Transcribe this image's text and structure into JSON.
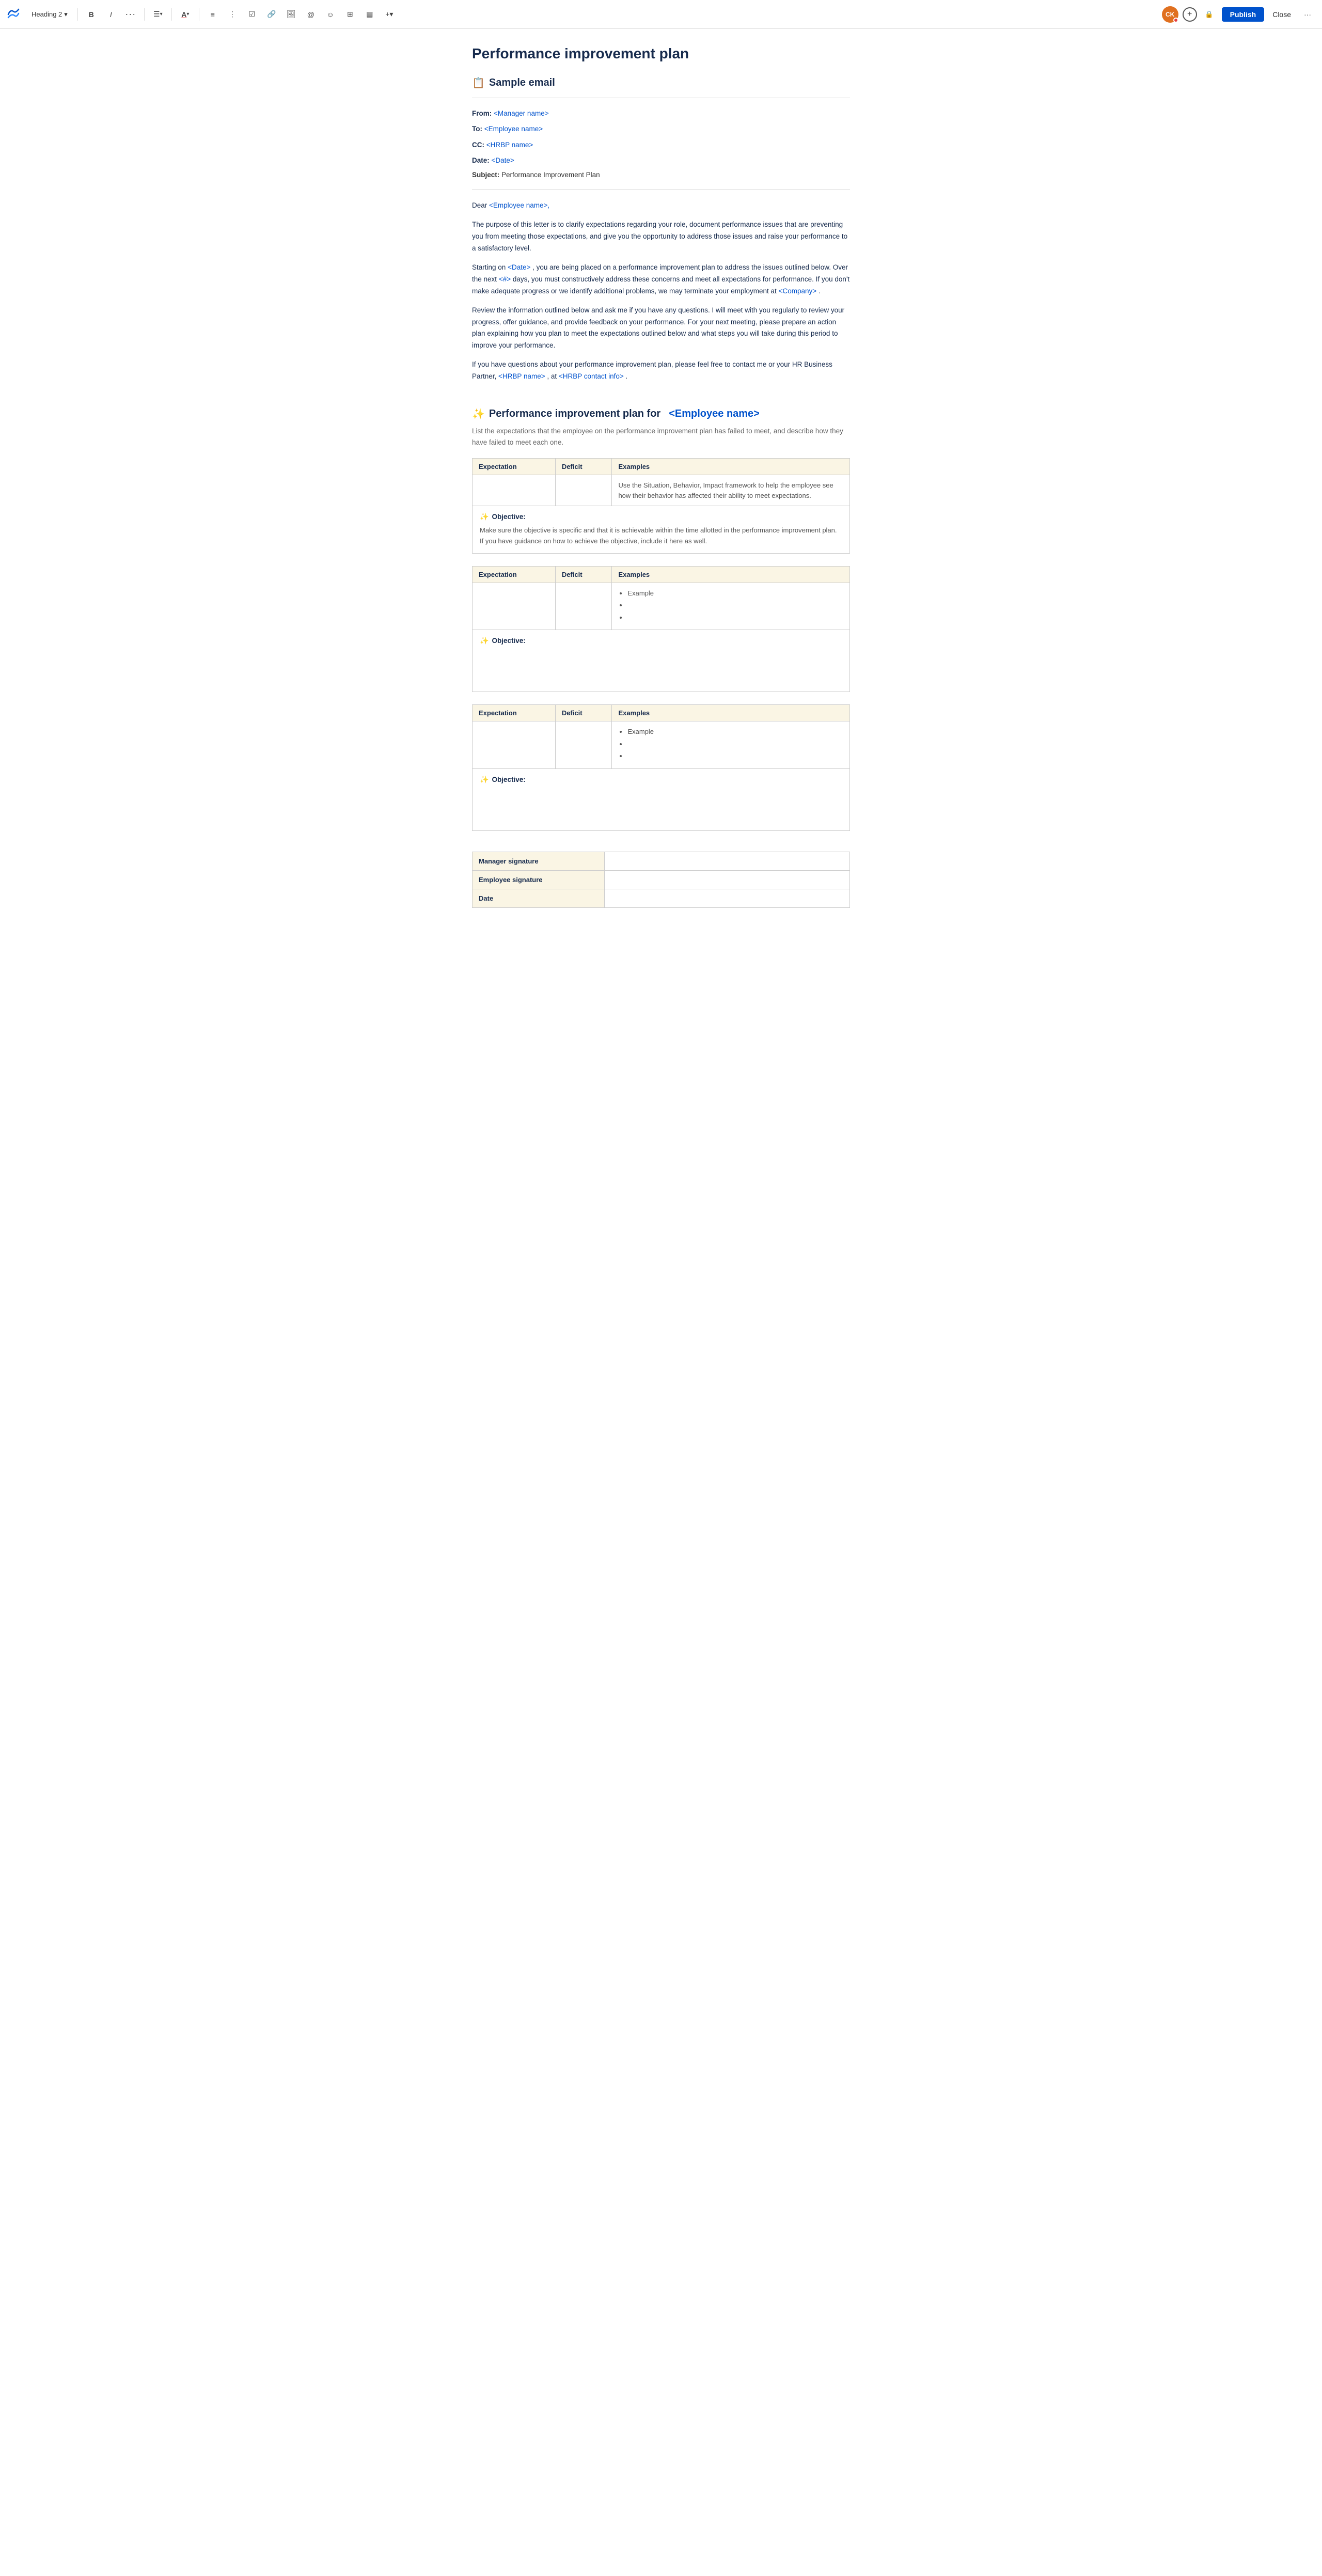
{
  "toolbar": {
    "logo_alt": "Confluence logo",
    "heading_selector": "Heading 2",
    "chevron": "▾",
    "bold": "B",
    "italic": "I",
    "more_format": "···",
    "align": "≡",
    "align_chevron": "▾",
    "text_color": "A",
    "text_color_chevron": "▾",
    "bullet_list": "≡",
    "numbered_list": "≡",
    "task": "☑",
    "link": "🔗",
    "image": "🖼",
    "mention": "@",
    "emoji": "☺",
    "table": "⊞",
    "more_plus": "+▾",
    "avatar_initials": "CK",
    "plus_icon": "+",
    "lock_icon": "🔒",
    "publish_label": "Publish",
    "close_label": "Close",
    "more_options": "···"
  },
  "page": {
    "title": "Performance improvement plan"
  },
  "email_section": {
    "heading_emoji": "📋",
    "heading": "Sample email",
    "from_label": "From:",
    "from_value": "<Manager name>",
    "to_label": "To:",
    "to_value": "<Employee name>",
    "cc_label": "CC:",
    "cc_value": "<HRBP name>",
    "date_label": "Date:",
    "date_value": "<Date>",
    "subject_label": "Subject:",
    "subject_value": "Performance Improvement Plan",
    "dear_text": "Dear",
    "dear_placeholder": "<Employee name>,",
    "para1": "The purpose of this letter is to clarify expectations regarding your role, document performance issues that are preventing you from meeting those expectations, and give you the opportunity to address those issues and raise your performance to a satisfactory level.",
    "para2_start": "Starting on",
    "para2_date": "<Date>",
    "para2_mid1": ", you are being placed on a performance improvement plan to address the issues outlined below. Over the next",
    "para2_num": "<#>",
    "para2_mid2": "days, you must constructively address these concerns and meet all expectations for performance. If you don't make adequate progress or we identify additional problems, we may terminate your employment at",
    "para2_company": "<Company>",
    "para2_end": ".",
    "para3": "Review the information outlined below and ask me if you have any questions. I will meet with you regularly to review your progress, offer guidance, and provide feedback on your performance. For your next meeting, please prepare an action plan explaining how you plan to meet the expectations outlined below and what steps you will take during this period to improve your performance.",
    "para4_start": "If you have questions about your performance improvement plan, please feel free to contact me or your HR Business Partner,",
    "para4_name": "<HRBP name>",
    "para4_mid": ", at",
    "para4_contact": "<HRBP contact info>",
    "para4_end": "."
  },
  "pip_section": {
    "heading_emoji": "✨",
    "heading_text": "Performance improvement plan for",
    "employee_placeholder": "<Employee name>",
    "description": "List the expectations that the employee on the performance improvement plan has failed to meet, and describe how they have failed to meet each one.",
    "table_headers": {
      "expectation": "Expectation",
      "deficit": "Deficit",
      "examples": "Examples"
    },
    "table1": {
      "expectation_cell": "",
      "deficit_cell": "",
      "examples_text": "Use the Situation, Behavior, Impact framework to help the employee see how their behavior has affected their ability to meet expectations."
    },
    "objective1": {
      "emoji": "✨",
      "label": "Objective:",
      "text": "Make sure the objective is specific and that it is achievable within the time allotted in the performance improvement plan. If you have guidance on how to achieve the objective, include it here as well."
    },
    "table2": {
      "expectation_cell": "",
      "deficit_cell": "",
      "examples_items": [
        "Example",
        "",
        ""
      ]
    },
    "objective2": {
      "emoji": "✨",
      "label": "Objective:",
      "text": ""
    },
    "table3": {
      "expectation_cell": "",
      "deficit_cell": "",
      "examples_items": [
        "Example",
        "",
        ""
      ]
    },
    "objective3": {
      "emoji": "✨",
      "label": "Objective:",
      "text": ""
    },
    "signature_rows": [
      {
        "label": "Manager signature",
        "value": ""
      },
      {
        "label": "Employee signature",
        "value": ""
      },
      {
        "label": "Date",
        "value": ""
      }
    ]
  }
}
